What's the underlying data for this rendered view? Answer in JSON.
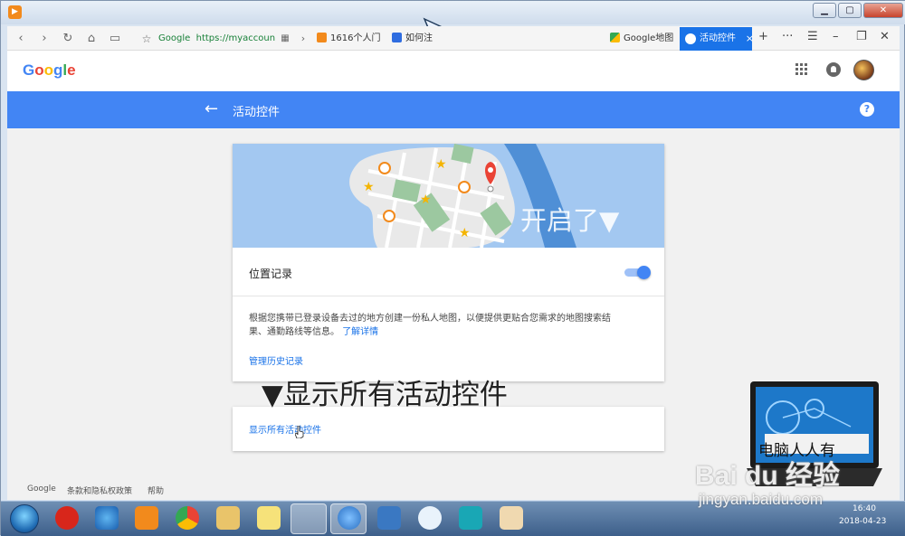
{
  "browser": {
    "url_prefix": "Google",
    "url_secure": "https://myaccoun",
    "tabs": [
      {
        "label": "1616个人门"
      },
      {
        "label": "如何注"
      },
      {
        "label": "Google地图"
      }
    ],
    "active_tab": "活动控件",
    "close_glyph": "×",
    "ctl_new": "+",
    "ctl_more": "···",
    "ctl_menu": "☰",
    "ctl_min": "–",
    "ctl_max": "❐",
    "ctl_close": "✕"
  },
  "header": {
    "logo_letters": [
      "G",
      "o",
      "o",
      "g",
      "l",
      "e"
    ],
    "logo_colors": [
      "#4285f4",
      "#ea4335",
      "#fbbc05",
      "#4285f4",
      "#34a853",
      "#ea4335"
    ]
  },
  "bluebar": {
    "back_glyph": "←",
    "title": "活动控件",
    "help_glyph": "?",
    "color": "#4285f4"
  },
  "location_card": {
    "toggle_label": "位置记录",
    "toggle_on": true,
    "description": "根据您携带已登录设备去过的地方创建一份私人地图，以便提供更贴合您需求的地图搜索结果、通勤路线等信息。",
    "learn_more": "了解详情",
    "manage_link": "管理历史记录"
  },
  "show_all_card": {
    "link": "显示所有活动控件"
  },
  "overlays": {
    "opened": "开启了▼",
    "show_all": "▼显示所有活动控件"
  },
  "footer": {
    "google": "Google",
    "terms": "条款和隐私权政策",
    "help": "帮助"
  },
  "taskbar": {
    "time": "16:40",
    "date": "2018-04-23"
  },
  "watermark": {
    "brand": "Bai du 经验",
    "url": "jingyan.baidu.com",
    "laptop_caption": "电脑人人有"
  }
}
